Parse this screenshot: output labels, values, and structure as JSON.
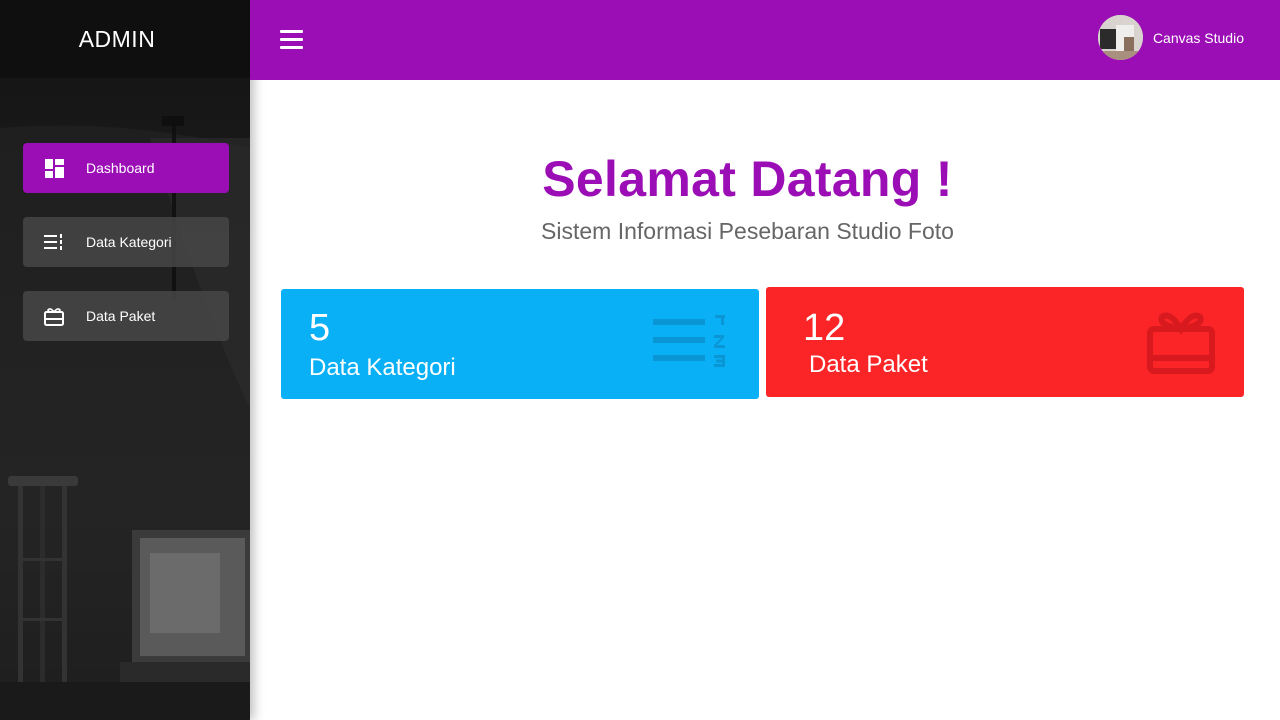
{
  "sidebar": {
    "brand": "ADMIN",
    "items": [
      {
        "label": "Dashboard",
        "icon": "dashboard-icon",
        "active": true
      },
      {
        "label": "Data Kategori",
        "icon": "list-numbered-icon",
        "active": false
      },
      {
        "label": "Data Paket",
        "icon": "gift-card-icon",
        "active": false
      }
    ]
  },
  "topbar": {
    "menu_icon": "hamburger-icon",
    "user_name": "Canvas Studio"
  },
  "main": {
    "title": "Selamat Datang !",
    "subtitle": "Sistem Informasi Pesebaran Studio Foto",
    "cards": [
      {
        "count": "5",
        "label": "Data Kategori",
        "color": "#0ab0f5",
        "icon": "list-numbered-icon"
      },
      {
        "count": "12",
        "label": "Data Paket",
        "color": "#fb2527",
        "icon": "gift-card-icon"
      }
    ]
  },
  "colors": {
    "accent": "#9b0db5",
    "sidebar_bg": "#1c1c1c",
    "subtitle": "#666666"
  }
}
